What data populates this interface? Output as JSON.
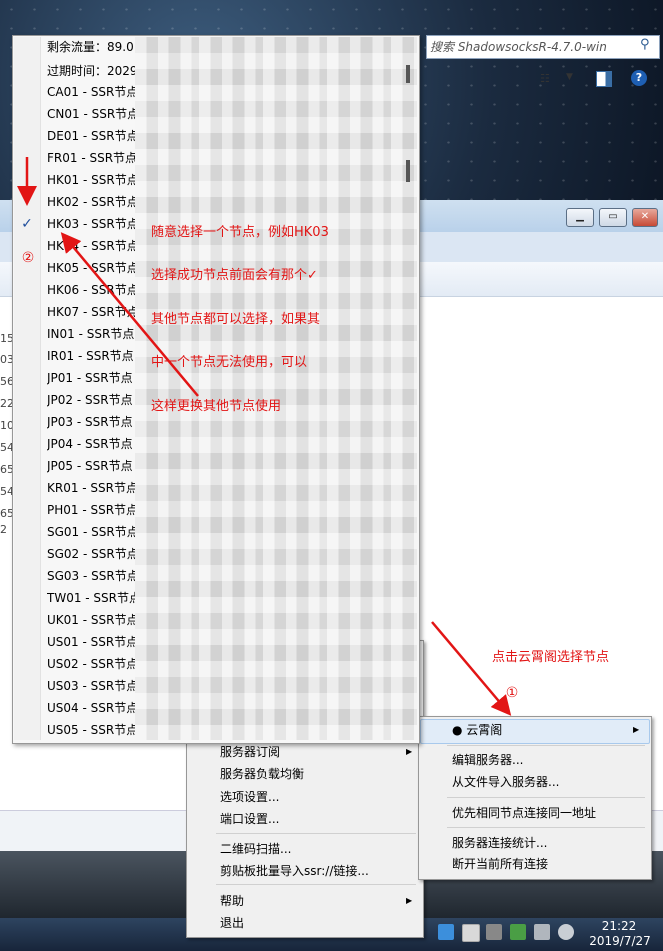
{
  "explorer": {
    "search_placeholder": "搜索 ShadowsocksR-4.7.0-win",
    "left_column_numbers": [
      "15",
      "03",
      "56",
      "22",
      "10",
      "54",
      "65",
      "54",
      "65",
      "2"
    ]
  },
  "server_menu": {
    "header_items": [
      "剩余流量：89.0",
      "过期时间：2029"
    ],
    "items": [
      "CA01 - SSR节点",
      "CN01 - SSR节点",
      "DE01 - SSR节点",
      "FR01 - SSR节点",
      "HK01 - SSR节点",
      "HK02 - SSR节点",
      "HK03 - SSR节点",
      "HK04 - SSR节点",
      "HK05 - SSR节点",
      "HK06 - SSR节点",
      "HK07 - SSR节点",
      "IN01 - SSR节点",
      "IR01 - SSR节点",
      "JP01 - SSR节点",
      "JP02 - SSR节点",
      "JP03 - SSR节点",
      "JP04 - SSR节点",
      "JP05 - SSR节点",
      "KR01 - SSR节点",
      "PH01 - SSR节点",
      "SG01 - SSR节点",
      "SG02 - SSR节点",
      "SG03 - SSR节点",
      "TW01 - SSR节点",
      "UK01 - SSR节点",
      "US01 - SSR节点",
      "US02 - SSR节点",
      "US03 - SSR节点",
      "US04 - SSR节点",
      "US05 - SSR节点"
    ],
    "selected_index": 6,
    "check_glyph": "✓"
  },
  "context_menu": {
    "items": [
      "服务器订阅",
      "服务器负载均衡",
      "选项设置...",
      "端口设置...",
      "二维码扫描...",
      "剪贴板批量导入ssr://链接...",
      "帮助",
      "退出"
    ]
  },
  "cloud_submenu": {
    "highlighted": "● 云霄阁",
    "items": [
      "编辑服务器...",
      "从文件导入服务器...",
      "优先相同节点连接同一地址",
      "服务器连接统计...",
      "断开当前所有连接"
    ]
  },
  "annotations": {
    "instructions": [
      "随意选择一个节点，例如HK03",
      "选择成功节点前面会有那个✓",
      "其他节点都可以选择，如果其",
      "中一个节点无法使用，可以",
      "这样更换其他节点使用"
    ],
    "step1_text": "点击云霄阁选择节点",
    "step1_marker": "①",
    "step2_marker": "②"
  },
  "clock": {
    "time": "21:22",
    "date": "2019/7/27"
  },
  "colors": {
    "annotation_red": "#e21515",
    "highlight": "#e1ecf8"
  }
}
